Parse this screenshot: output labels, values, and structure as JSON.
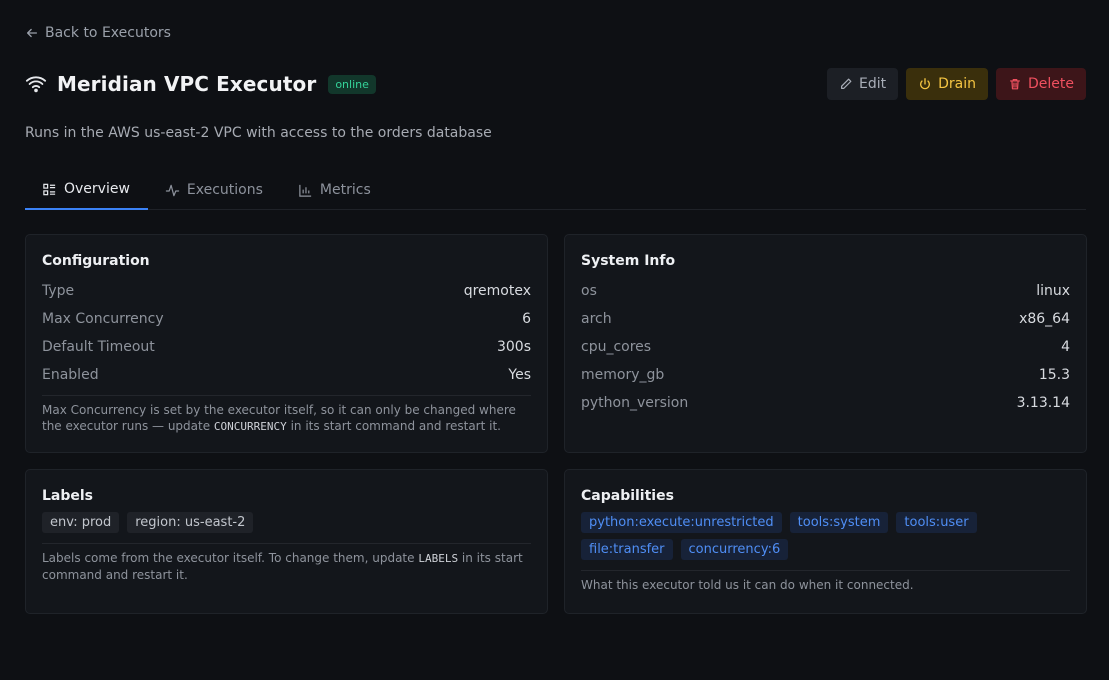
{
  "nav": {
    "back_label": "Back to Executors"
  },
  "header": {
    "title": "Meridian VPC Executor",
    "status": "online",
    "status_color": "#34d399",
    "icon": "wifi-icon",
    "edit_label": "Edit",
    "drain_label": "Drain",
    "delete_label": "Delete"
  },
  "description": "Runs in the AWS us-east-2 VPC with access to the orders database",
  "tabs": [
    {
      "label": "Overview",
      "icon": "overview-icon",
      "active": true
    },
    {
      "label": "Executions",
      "icon": "activity-icon",
      "active": false
    },
    {
      "label": "Metrics",
      "icon": "bar-chart-icon",
      "active": false
    }
  ],
  "configuration": {
    "title": "Configuration",
    "rows": [
      {
        "key": "Type",
        "value": "qremotex"
      },
      {
        "key": "Max Concurrency",
        "value": "6"
      },
      {
        "key": "Default Timeout",
        "value": "300s"
      },
      {
        "key": "Enabled",
        "value": "Yes"
      }
    ],
    "note_before": "Max Concurrency is set by the executor itself, so it can only be changed where the executor runs — update ",
    "note_code": "CONCURRENCY",
    "note_after": " in its start command and restart it."
  },
  "system_info": {
    "title": "System Info",
    "rows": [
      {
        "key": "os",
        "value": "linux"
      },
      {
        "key": "arch",
        "value": "x86_64"
      },
      {
        "key": "cpu_cores",
        "value": "4"
      },
      {
        "key": "memory_gb",
        "value": "15.3"
      },
      {
        "key": "python_version",
        "value": "3.13.14"
      }
    ]
  },
  "labels": {
    "title": "Labels",
    "items": [
      "env: prod",
      "region: us-east-2"
    ],
    "note_before": "Labels come from the executor itself. To change them, update ",
    "note_code": "LABELS",
    "note_after": " in its start command and restart it."
  },
  "capabilities": {
    "title": "Capabilities",
    "items": [
      "python:execute:unrestricted",
      "tools:system",
      "tools:user",
      "file:transfer",
      "concurrency:6"
    ],
    "note": "What this executor told us it can do when it connected."
  },
  "colors": {
    "accent": "#3b82f6",
    "drain": "#f5c542",
    "delete": "#f0505f"
  }
}
